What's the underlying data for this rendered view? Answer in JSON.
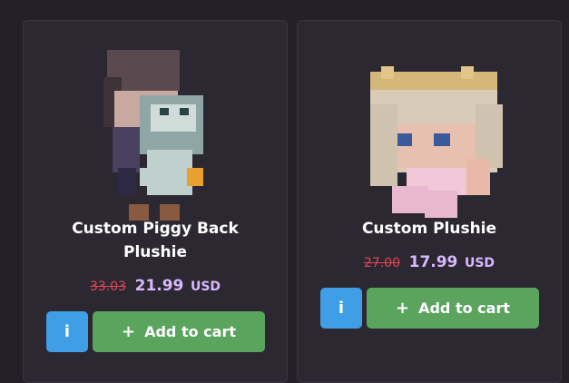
{
  "products": [
    {
      "title": "Custom Piggy Back Plushie",
      "old_price": "33.03",
      "new_price": "21.99",
      "currency": "USD",
      "info_label": "i",
      "cart_label": "Add to cart",
      "plus_icon": "+"
    },
    {
      "title": "Custom Plushie",
      "old_price": "27.00",
      "new_price": "17.99",
      "currency": "USD",
      "info_label": "i",
      "cart_label": "Add to cart",
      "plus_icon": "+"
    }
  ],
  "colors": {
    "background": "#242027",
    "card": "#2c2831",
    "info_button": "#3f9ee6",
    "cart_button": "#5aa45e",
    "old_price": "#e0455a",
    "new_price": "#d8b8ff"
  }
}
